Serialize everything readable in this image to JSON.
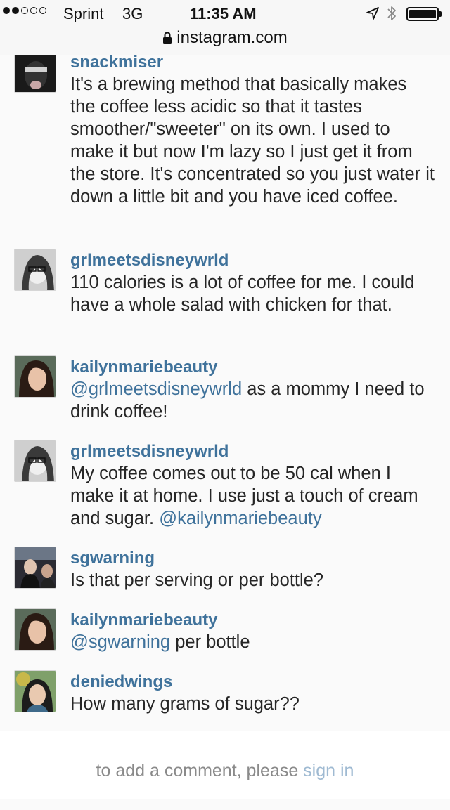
{
  "status_bar": {
    "carrier": "Sprint",
    "network": "3G",
    "time": "11:35 AM",
    "signal_bars_filled": 2,
    "signal_bars_total": 5
  },
  "browser": {
    "url": "instagram.com"
  },
  "colors": {
    "username": "#3f729b",
    "text": "#262626",
    "signin": "#9fbad2"
  },
  "comments": [
    {
      "username": "snackmiser",
      "text": "It's a brewing method that basically makes the coffee less acidic so that it tastes smoother/\"sweeter\" on its own. I used to make it but now I'm lazy so I just get it from the store. It's concentrated so you just water it down a little bit and you have iced coffee."
    },
    {
      "username": "grlmeetsdisneywrld",
      "text": "110 calories is a lot of coffee for me. I could have a whole salad with chicken for that."
    },
    {
      "username": "kailynmariebeauty",
      "mention": "@grlmeetsdisneywrld",
      "text": " as a mommy I need to drink coffee!"
    },
    {
      "username": "grlmeetsdisneywrld",
      "text": "My coffee comes out to be 50 cal when I make it at home. I use just a touch of cream and sugar. ",
      "mention": "@kailynmariebeauty"
    },
    {
      "username": "sgwarning",
      "text": "Is that per serving or per bottle?"
    },
    {
      "username": "kailynmariebeauty",
      "mention": "@sgwarning",
      "text": " per bottle"
    },
    {
      "username": "deniedwings",
      "text": "How many grams of sugar??"
    }
  ],
  "footer": {
    "prompt": "to add a comment, please ",
    "signin_link": "sign in"
  }
}
